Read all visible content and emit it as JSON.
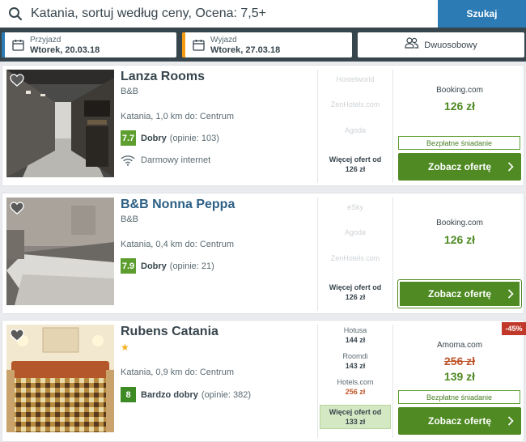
{
  "search": {
    "query": "Katania, sortuj według ceny, Ocena: 7,5+",
    "button_label": "Szukaj"
  },
  "dates": {
    "checkin_label": "Przyjazd",
    "checkin_value": "Wtorek, 20.03.18",
    "checkout_label": "Wyjazd",
    "checkout_value": "Wtorek, 27.03.18",
    "room_label": "Dwuosobowy"
  },
  "colors": {
    "header_bg": "#37454d",
    "search_button": "#2c7bb5",
    "checkin_accent": "#2c7bb5",
    "checkout_accent": "#f39c12",
    "cta_green": "#4f8a23",
    "discount_red": "#c0392b"
  },
  "hotels": [
    {
      "name": "Lanza Rooms",
      "type": "B&B",
      "location": "Katania, 1,0 km do: Centrum",
      "rating_score": "7.7",
      "rating_word": "Dobry",
      "rating_count": "(opinie: 103)",
      "amenity": "Darmowy internet",
      "amenity_icon": "wifi-icon",
      "other_offers": [
        "Hostelworld",
        "ZenHotels.com",
        "Agoda"
      ],
      "more_offers_line1": "Więcej ofert od",
      "more_offers_line2": "126 zł",
      "provider": "Booking.com",
      "price": "126 zł",
      "perk": "Bezpłatne śniadanie",
      "cta_label": "Zobacz ofertę"
    },
    {
      "name": "B&B Nonna Peppa",
      "type": "B&B",
      "location": "Katania, 0,4 km do: Centrum",
      "rating_score": "7.9",
      "rating_word": "Dobry",
      "rating_count": "(opinie: 21)",
      "other_offers": [
        "eSky",
        "Agoda",
        "ZenHotels.com"
      ],
      "more_offers_line1": "Więcej ofert od",
      "more_offers_line2": "126 zł",
      "provider": "Booking.com",
      "price": "126 zł",
      "cta_label": "Zobacz ofertę"
    },
    {
      "name": "Rubens Catania",
      "stars": "★",
      "location": "Katania, 0,9 km do: Centrum",
      "rating_score": "8",
      "rating_word": "Bardzo dobry",
      "rating_count": "(opinie: 382)",
      "other_offers": [
        {
          "name": "Hotusa",
          "price": "144 zł"
        },
        {
          "name": "Roomdi",
          "price": "143 zł"
        },
        {
          "name": "Hotels.com",
          "price": "256 zł"
        }
      ],
      "more_offers_line1": "Więcej ofert od",
      "more_offers_line2": "133 zł",
      "provider": "Amoma.com",
      "old_price": "256 zł",
      "price": "139 zł",
      "perk": "Bezpłatne śniadanie",
      "discount": "-45%",
      "cta_label": "Zobacz ofertę"
    }
  ]
}
